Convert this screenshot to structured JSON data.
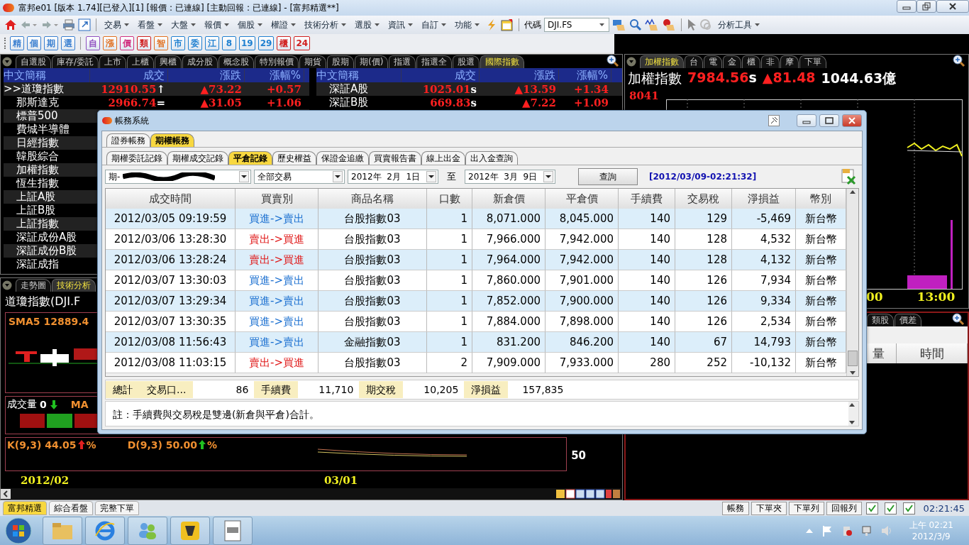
{
  "window": {
    "title": "富邦e01 [版本 1.74][已登入][1] [報價 : 已連線] [主動回報 : 已連線] - [富邦精選**]"
  },
  "menu": [
    "交易",
    "看盤",
    "大盤",
    "報價",
    "個股",
    "權證",
    "技術分析",
    "選股",
    "資訊",
    "自訂",
    "功能"
  ],
  "symbol": {
    "label": "代碼",
    "value": "DJI.FS"
  },
  "analysis_menu": "分析工具",
  "quick_buttons": [
    {
      "label": "精",
      "color": "#3a7fd0"
    },
    {
      "label": "個",
      "color": "#3a7fd0"
    },
    {
      "label": "期",
      "color": "#3a7fd0"
    },
    {
      "label": "選",
      "color": "#3a7fd0"
    },
    {
      "label": "自",
      "color": "#9050c0"
    },
    {
      "label": "漲",
      "color": "#e07020"
    },
    {
      "label": "價",
      "color": "#d03080"
    },
    {
      "label": "類",
      "color": "#d02020"
    },
    {
      "label": "智",
      "color": "#e07020"
    },
    {
      "label": "市",
      "color": "#2080d0"
    },
    {
      "label": "委",
      "color": "#2080d0"
    },
    {
      "label": "江",
      "color": "#2080d0"
    },
    {
      "label": "8",
      "color": "#2080d0"
    },
    {
      "label": "19",
      "color": "#2080d0"
    },
    {
      "label": "29",
      "color": "#2080d0"
    },
    {
      "label": "櫃",
      "color": "#d02020"
    },
    {
      "label": "24",
      "color": "#d02020"
    }
  ],
  "quote_panel": {
    "tabs": [
      {
        "label": "自選股",
        "selected": false
      },
      {
        "label": "庫存/委託",
        "selected": false
      },
      {
        "label": "上市",
        "selected": false
      },
      {
        "label": "上櫃",
        "selected": false
      },
      {
        "label": "興櫃",
        "selected": false
      },
      {
        "label": "成分股",
        "selected": false
      },
      {
        "label": "概念股",
        "selected": false
      },
      {
        "label": "特別報價",
        "selected": false
      },
      {
        "label": "期貨",
        "selected": false
      },
      {
        "label": "股期",
        "selected": false
      },
      {
        "label": "期(價)",
        "selected": false
      },
      {
        "label": "指選",
        "selected": false
      },
      {
        "label": "指選全",
        "selected": false
      },
      {
        "label": "股選",
        "selected": false
      },
      {
        "label": "國際指數",
        "selected": true
      }
    ],
    "columns": [
      "中文簡稱",
      "成交",
      "漲跌",
      "漲幅%"
    ],
    "left_rows": [
      {
        "pointer": ">>",
        "name": "道瓊指數",
        "price": "12910.55",
        "flag": "↑",
        "change": "▲73.22",
        "pct": "+0.57"
      },
      {
        "name": "那斯達克",
        "price": "2966.74",
        "flag": "=",
        "change": "▲31.05",
        "pct": "+1.06"
      },
      {
        "name": "標普500"
      },
      {
        "name": "費城半導體"
      },
      {
        "name": "日經指數"
      },
      {
        "name": "韓股綜合"
      },
      {
        "name": "加權指數"
      },
      {
        "name": "恆生指數"
      },
      {
        "name": "上証A股"
      },
      {
        "name": "上証B股"
      },
      {
        "name": "上証指數"
      },
      {
        "name": "深証成份A股"
      },
      {
        "name": "深証成份B股"
      },
      {
        "name": "深証成指"
      }
    ],
    "right_columns": [
      "中文簡稱",
      "成交",
      "漲跌",
      "漲幅%"
    ],
    "right_rows": [
      {
        "name": "深証A股",
        "price": "1025.01",
        "flag": "s",
        "change": "▲13.59",
        "pct": "+1.34"
      },
      {
        "name": "深証B股",
        "price": "669.83",
        "flag": "s",
        "change": "▲7.22",
        "pct": "+1.09"
      }
    ]
  },
  "chart_panel": {
    "tabs": [
      {
        "label": "走勢圖",
        "selected": false
      },
      {
        "label": "技術分析",
        "selected": true
      }
    ],
    "title": "道瓊指數(DJI.F",
    "sma": "SMA5 12889.4",
    "volume_label": "成交量",
    "volume_value": "0",
    "volume_ma": "MA",
    "k_label": "K(9,3) 44.05",
    "k_unit": "%",
    "d_label": "D(9,3) 50.00",
    "d_unit": "%",
    "axis_value": "50",
    "dates": [
      "2012/02",
      "03/01"
    ]
  },
  "index_panel": {
    "tabs": [
      {
        "label": "加權指數",
        "selected": true
      },
      {
        "label": "台",
        "selected": false
      },
      {
        "label": "電",
        "selected": false
      },
      {
        "label": "金",
        "selected": false
      },
      {
        "label": "櫃",
        "selected": false
      },
      {
        "label": "非",
        "selected": false
      },
      {
        "label": "摩",
        "selected": false
      },
      {
        "label": "下單",
        "selected": false
      }
    ],
    "name": "加權指數",
    "price": "7984.56",
    "flag": "s",
    "change": "▲81.48",
    "amount": "1044.63億",
    "y_high": "8041",
    "times": [
      "00",
      "13:00"
    ]
  },
  "detail_panel": {
    "tabs": [
      {
        "label": "類股",
        "selected": false
      },
      {
        "label": "價差",
        "selected": false
      }
    ],
    "columns": [
      "量",
      "時間"
    ]
  },
  "dialog": {
    "title": "帳務系統",
    "outer_tabs": [
      {
        "label": "證券帳務",
        "selected": false
      },
      {
        "label": "期權帳務",
        "selected": true
      }
    ],
    "inner_tabs": [
      {
        "label": "期權委託記錄",
        "selected": false
      },
      {
        "label": "期權成交記錄",
        "selected": false
      },
      {
        "label": "平倉記錄",
        "selected": true
      },
      {
        "label": "歷史權益",
        "selected": false
      },
      {
        "label": "保證金追繳",
        "selected": false
      },
      {
        "label": "買賣報告書",
        "selected": false
      },
      {
        "label": "線上出金",
        "selected": false
      },
      {
        "label": "出入金查詢",
        "selected": false
      }
    ],
    "account": "期-",
    "trade_type": "全部交易",
    "date_from": "2012年  2月  1日",
    "to_label": "至",
    "date_to": "2012年  3月  9日",
    "query_button": "查詢",
    "timestamp": "[2012/03/09-02:21:32]",
    "columns": [
      "成交時間",
      "買賣別",
      "商品名稱",
      "口數",
      "新倉價",
      "平倉價",
      "手續費",
      "交易稅",
      "淨損益",
      "幣別"
    ],
    "rows": [
      {
        "time": "2012/03/05 09:19:59",
        "side": "買進->賣出",
        "kind": "buy_sell",
        "product": "台股指數03",
        "qty": "1",
        "open": "8,071.000",
        "close": "8,045.000",
        "fee": "140",
        "tax": "129",
        "pnl": "-5,469",
        "currency": "新台幣"
      },
      {
        "time": "2012/03/06 13:28:30",
        "side": "賣出->買進",
        "kind": "sell_buy",
        "product": "台股指數03",
        "qty": "1",
        "open": "7,966.000",
        "close": "7,942.000",
        "fee": "140",
        "tax": "128",
        "pnl": "4,532",
        "currency": "新台幣"
      },
      {
        "time": "2012/03/06 13:28:24",
        "side": "賣出->買進",
        "kind": "sell_buy",
        "product": "台股指數03",
        "qty": "1",
        "open": "7,964.000",
        "close": "7,942.000",
        "fee": "140",
        "tax": "128",
        "pnl": "4,132",
        "currency": "新台幣"
      },
      {
        "time": "2012/03/07 13:30:03",
        "side": "買進->賣出",
        "kind": "buy_sell",
        "product": "台股指數03",
        "qty": "1",
        "open": "7,860.000",
        "close": "7,901.000",
        "fee": "140",
        "tax": "126",
        "pnl": "7,934",
        "currency": "新台幣"
      },
      {
        "time": "2012/03/07 13:29:34",
        "side": "買進->賣出",
        "kind": "buy_sell",
        "product": "台股指數03",
        "qty": "1",
        "open": "7,852.000",
        "close": "7,900.000",
        "fee": "140",
        "tax": "126",
        "pnl": "9,334",
        "currency": "新台幣"
      },
      {
        "time": "2012/03/07 13:30:35",
        "side": "買進->賣出",
        "kind": "buy_sell",
        "product": "台股指數03",
        "qty": "1",
        "open": "7,884.000",
        "close": "7,898.000",
        "fee": "140",
        "tax": "126",
        "pnl": "2,534",
        "currency": "新台幣"
      },
      {
        "time": "2012/03/08 11:56:43",
        "side": "買進->賣出",
        "kind": "buy_sell",
        "product": "金融指數03",
        "qty": "1",
        "open": "831.200",
        "close": "846.200",
        "fee": "140",
        "tax": "67",
        "pnl": "14,793",
        "currency": "新台幣"
      },
      {
        "time": "2012/03/08 11:03:15",
        "side": "賣出->買進",
        "kind": "sell_buy",
        "product": "台股指數03",
        "qty": "2",
        "open": "7,909.000",
        "close": "7,933.000",
        "fee": "280",
        "tax": "252",
        "pnl": "-10,132",
        "currency": "新台幣"
      }
    ],
    "summary": [
      {
        "label": "總計"
      },
      {
        "label": "交易口...",
        "value": "86"
      },
      {
        "label": "手續費",
        "value": "11,710"
      },
      {
        "label": "期交稅",
        "value": "10,205"
      },
      {
        "label": "淨損益",
        "value": "157,835"
      }
    ],
    "note": "註：手續費與交易稅是雙邊(新倉與平倉)合計。"
  },
  "workspace_tabs": [
    {
      "label": "富邦精選",
      "selected": true
    },
    {
      "label": "綜合看盤",
      "selected": false
    },
    {
      "label": "完整下單",
      "selected": false
    }
  ],
  "status_bar": {
    "buttons": [
      "帳務",
      "下單夾",
      "下單列",
      "回報列"
    ],
    "checkboxes": [
      {
        "checked": true
      },
      {
        "checked": true
      },
      {
        "checked": true
      }
    ],
    "time": "02:21:45"
  },
  "taskbar": {
    "clock_time": "上午 02:21",
    "clock_date": "2012/3/9"
  }
}
